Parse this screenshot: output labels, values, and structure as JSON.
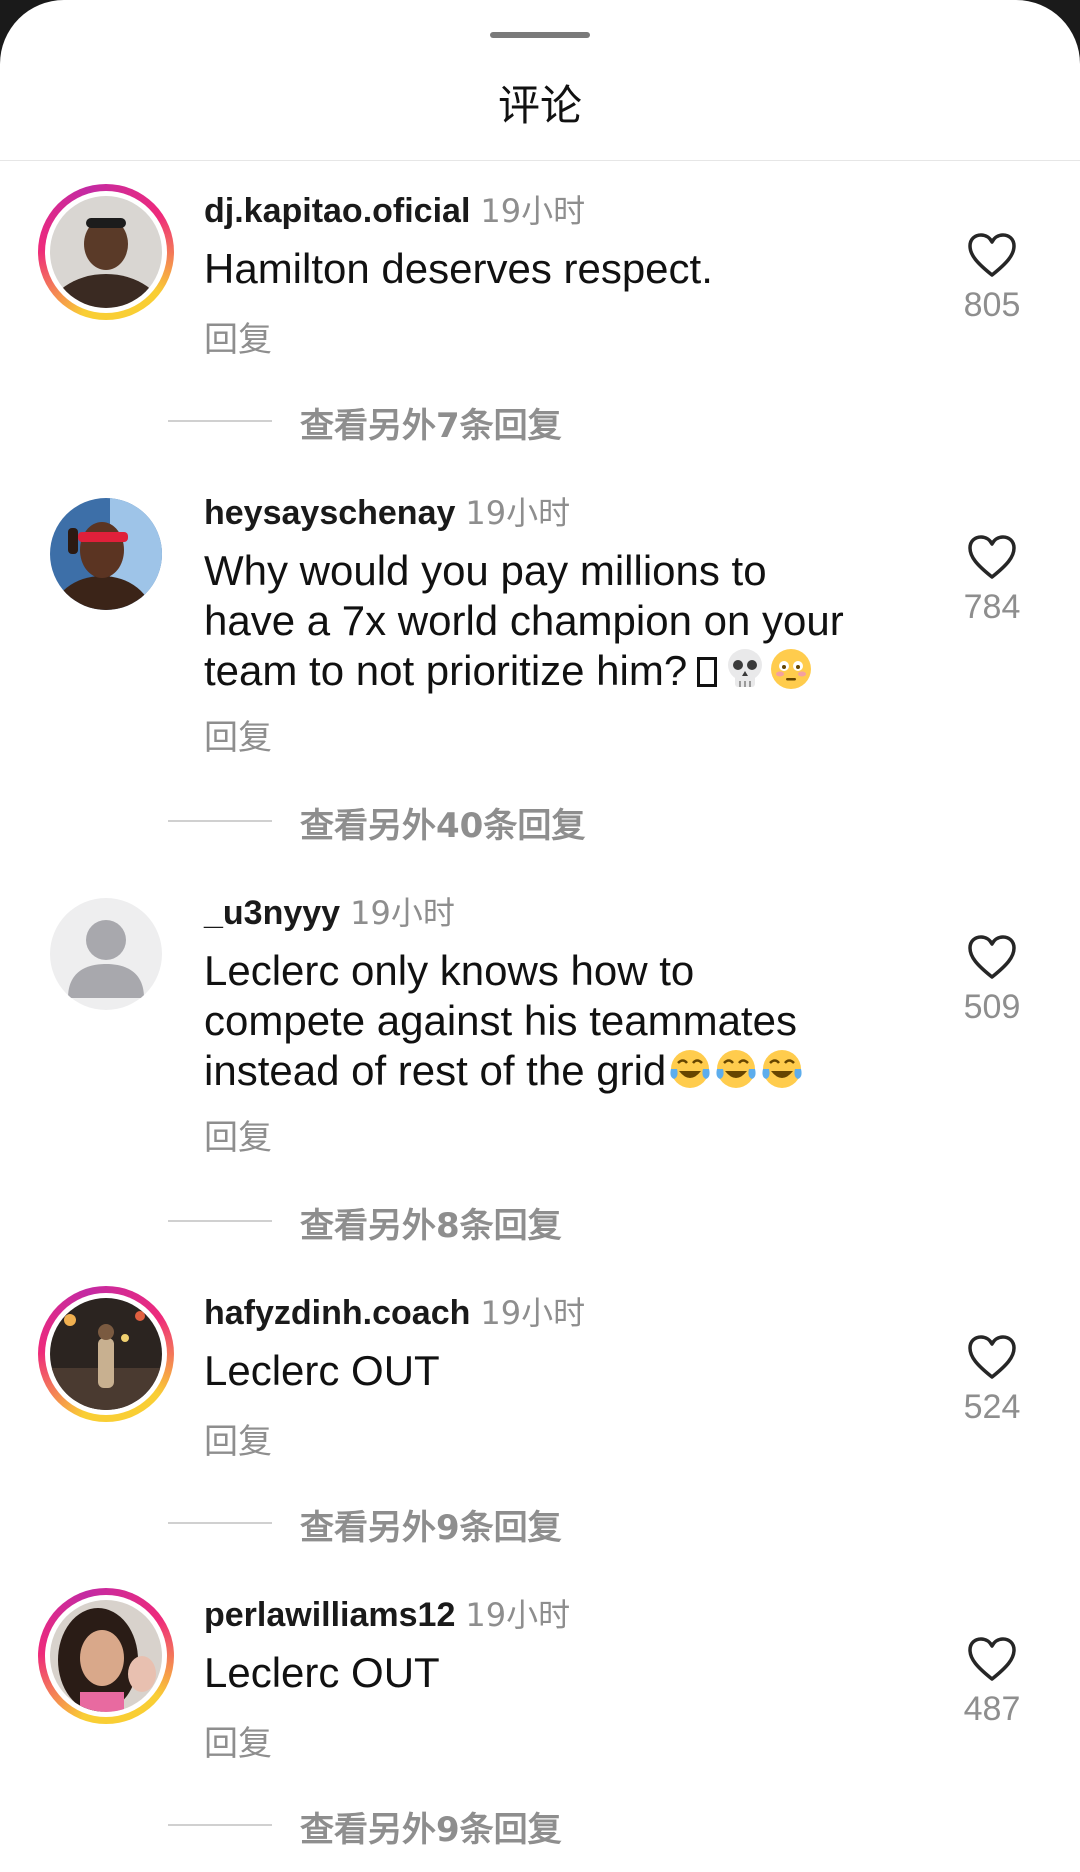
{
  "header": {
    "title": "评论"
  },
  "comments": [
    {
      "username": "dj.kapitao.oficial",
      "time": "19小时",
      "text": "Hamilton deserves respect.",
      "reply_label": "回复",
      "likes": "805",
      "more_replies": "查看另外7条回复",
      "has_story_ring": true
    },
    {
      "username": "heysayschenay",
      "time": "19小时",
      "text_lines": [
        "Why would you pay millions to",
        "have a 7x  world champion on your",
        "team to not prioritize him?"
      ],
      "emojis": [
        "missing-glyph",
        "skull",
        "flushed-face"
      ],
      "reply_label": "回复",
      "likes": "784",
      "more_replies": "查看另外40条回复",
      "has_story_ring": false
    },
    {
      "username": "_u3nyyy",
      "time": "19小时",
      "text_lines": [
        "Leclerc only knows how to",
        "compete against his teammates",
        "instead of rest of the grid"
      ],
      "emojis": [
        "tears-of-joy",
        "tears-of-joy",
        "tears-of-joy"
      ],
      "reply_label": "回复",
      "likes": "509",
      "more_replies": "查看另外8条回复",
      "has_story_ring": false
    },
    {
      "username": "hafyzdinh.coach",
      "time": "19小时",
      "text": "Leclerc OUT",
      "reply_label": "回复",
      "likes": "524",
      "more_replies": "查看另外9条回复",
      "has_story_ring": true
    },
    {
      "username": "perlawilliams12",
      "time": "19小时",
      "text": "Leclerc OUT",
      "reply_label": "回复",
      "likes": "487",
      "more_replies": "查看另外9条回复",
      "has_story_ring": true
    }
  ],
  "colors": {
    "secondary_text": "#8e8e8e",
    "primary_text": "#111111",
    "story_ring_start": "#f9ce34",
    "story_ring_end": "#ee2a7b"
  }
}
